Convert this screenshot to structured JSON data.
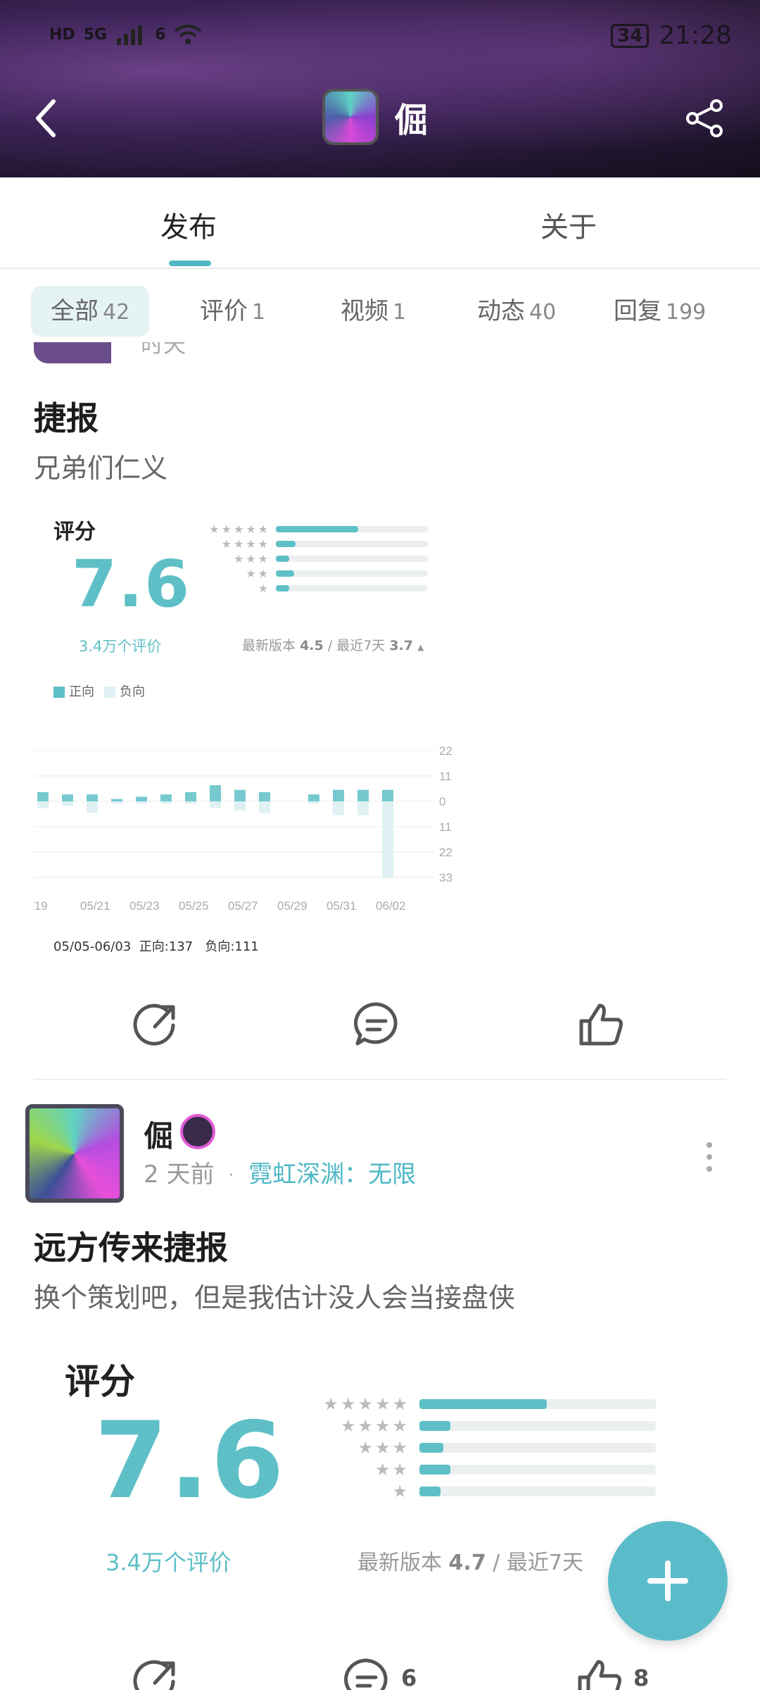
{
  "status_bar": {
    "left_icons": [
      "HD",
      "5G",
      "6"
    ],
    "battery": "34",
    "time": "21:28"
  },
  "header": {
    "name": "倔",
    "icons": [
      "back-arrow-icon",
      "share-icon"
    ]
  },
  "tabs": [
    {
      "label": "发布",
      "active": true
    },
    {
      "label": "关于",
      "active": false
    }
  ],
  "filters": [
    {
      "label": "全部",
      "count": "42",
      "active": true
    },
    {
      "label": "评价",
      "count": "1"
    },
    {
      "label": "视频",
      "count": "1"
    },
    {
      "label": "动态",
      "count": "40"
    },
    {
      "label": "回复",
      "count": "199"
    }
  ],
  "post1": {
    "partial_author_text": "时天",
    "title": "捷报",
    "body": "兄弟们仁义",
    "rating": {
      "label": "评分",
      "score": "7.6",
      "count": "3.4万个评价",
      "distribution": [
        0.54,
        0.13,
        0.09,
        0.12,
        0.09
      ],
      "version_label": "最新版本",
      "version_score": "4.5",
      "recent_label": "最近7天",
      "recent_score": "3.7",
      "trend_icon": "▲"
    },
    "chart_data": {
      "type": "bar",
      "legend": [
        "正向",
        "负向"
      ],
      "colors": {
        "positive": "#5ec0c6",
        "negative": "#dff1f3"
      },
      "y_ticks_right": [
        "22",
        "11",
        "0",
        "11",
        "22",
        "33"
      ],
      "ylim": [
        -33,
        22
      ],
      "x_tick_labels": [
        "/19",
        "05/21",
        "05/23",
        "05/25",
        "05/27",
        "05/29",
        "05/31",
        "06/02"
      ],
      "series": [
        {
          "name": "正向",
          "values": [
            4,
            3,
            3,
            1,
            2,
            3,
            4,
            7,
            5,
            4,
            0,
            3,
            5,
            5,
            5
          ]
        },
        {
          "name": "负向",
          "values": [
            -3,
            -2,
            -5,
            -1,
            -1,
            -1,
            -1,
            -3,
            -4,
            -5,
            0,
            -1,
            -6,
            -6,
            -33
          ]
        }
      ],
      "footer": {
        "range": "05/05-06/03",
        "positive_label": "正向",
        "positive": "137",
        "negative_label": "负向",
        "negative": "111"
      }
    },
    "actions": {
      "share_icon": "share-out-icon",
      "comment_icon": "comment-icon",
      "like_icon": "thumbs-up-icon"
    }
  },
  "post2": {
    "author": "倔",
    "time": "2 天前",
    "separator": "·",
    "game": "霓虹深渊：无限",
    "title": "远方传来捷报",
    "body": "换个策划吧，但是我估计没人会当接盘侠",
    "rating": {
      "label": "评分",
      "score": "7.6",
      "count": "3.4万个评价",
      "distribution": [
        0.54,
        0.13,
        0.1,
        0.13,
        0.09
      ],
      "version_label": "最新版本",
      "version_score": "4.7",
      "recent_label": "最近7天"
    },
    "actions": {
      "comments": "6",
      "likes": "8"
    }
  },
  "fab": {
    "icon": "plus-icon"
  }
}
